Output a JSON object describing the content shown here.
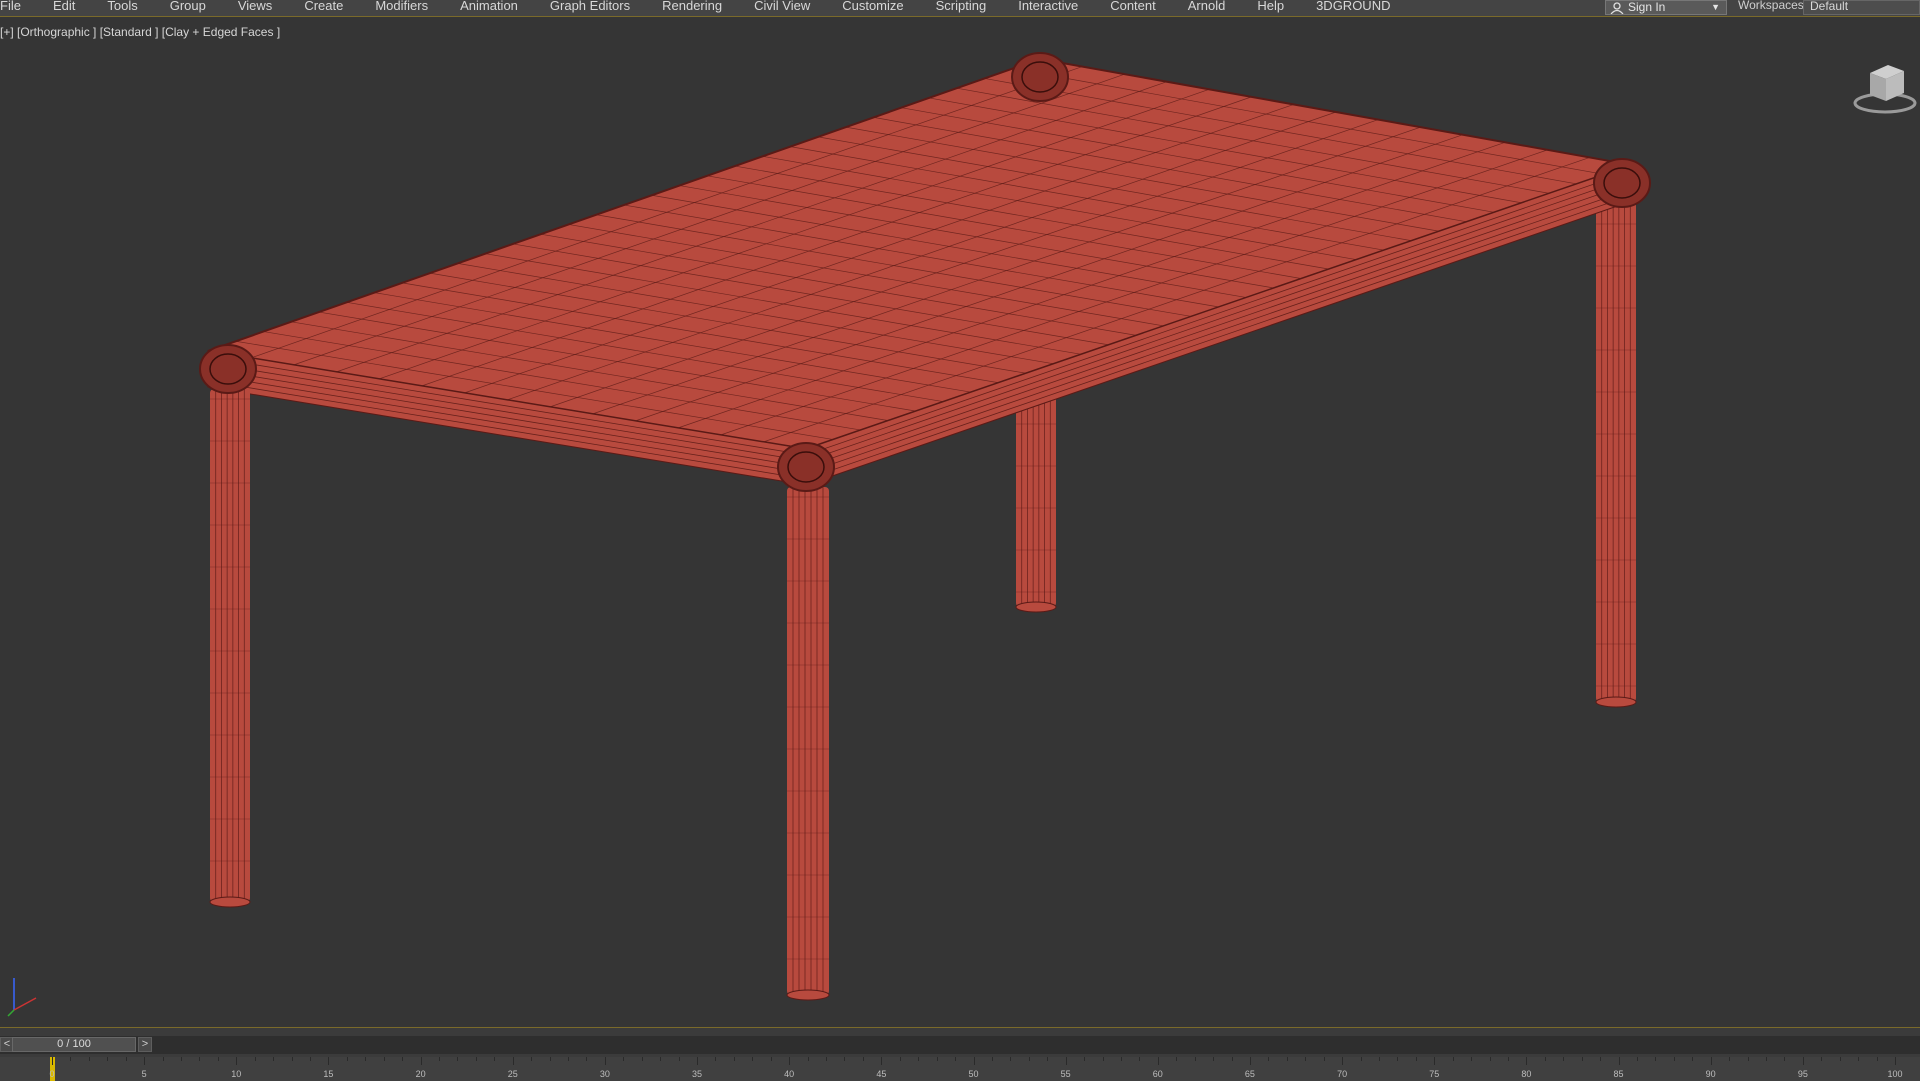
{
  "menu": {
    "items": [
      "File",
      "Edit",
      "Tools",
      "Group",
      "Views",
      "Create",
      "Modifiers",
      "Animation",
      "Graph Editors",
      "Rendering",
      "Civil View",
      "Customize",
      "Scripting",
      "Interactive",
      "Content",
      "Arnold",
      "Help",
      "3DGROUND"
    ]
  },
  "signin": {
    "label": "Sign In"
  },
  "workspaces": {
    "label": "Workspaces:",
    "value": "Default"
  },
  "viewport": {
    "label": "[+] [Orthographic ] [Standard ] [Clay + Edged Faces ]"
  },
  "timeline": {
    "position": "0 / 100",
    "prev_label": "<",
    "next_label": ">",
    "current_frame": 0,
    "ticks": [
      0,
      5,
      10,
      15,
      20,
      25,
      30,
      35,
      40,
      45,
      50,
      55,
      60,
      65,
      70,
      75,
      80,
      85,
      90,
      95,
      100
    ]
  },
  "colors": {
    "model": "#b84a3e",
    "wire": "#5a1a16",
    "background": "#353535",
    "frame_marker": "#d8b800"
  }
}
